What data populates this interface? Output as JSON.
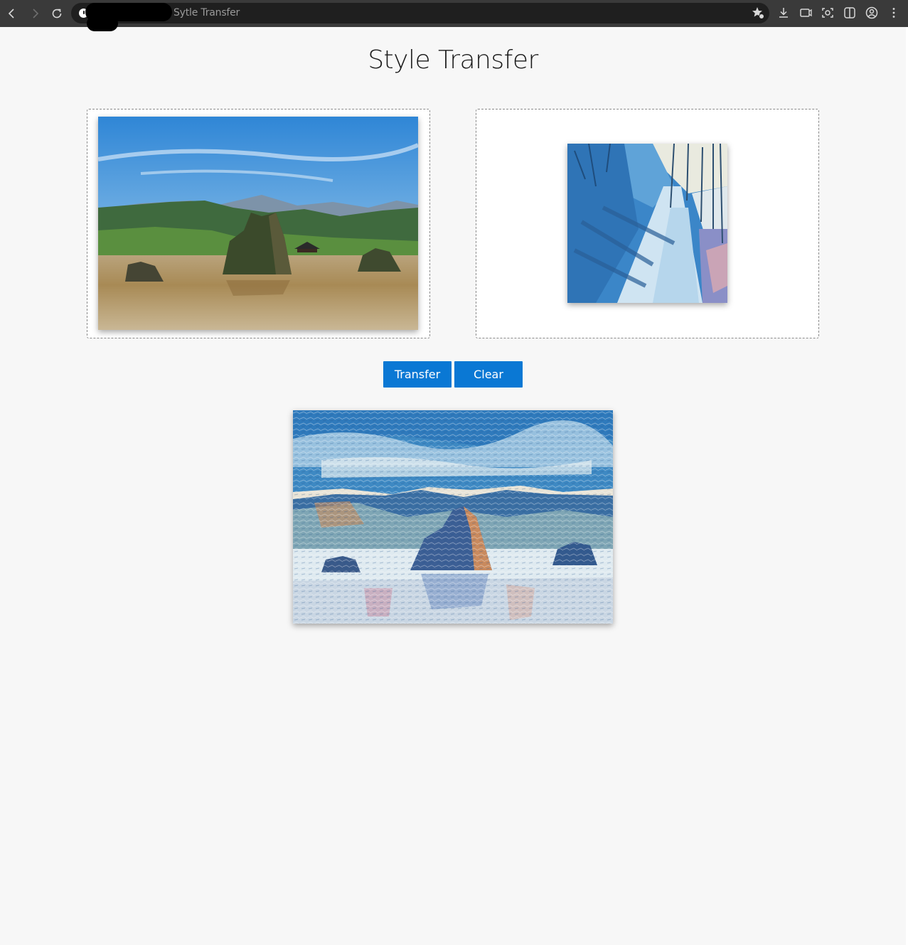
{
  "browser": {
    "tab_title": "Sytle Transfer",
    "icons": [
      "back-icon",
      "forward-icon",
      "reload-icon",
      "site-info-icon",
      "favorites-star-icon",
      "download-icon",
      "capture-icon",
      "screenshot-icon",
      "split-view-icon",
      "profile-icon",
      "menu-dots-icon"
    ]
  },
  "page": {
    "title": "Style Transfer"
  },
  "inputs": {
    "content_image": "content-landscape-river-rocks",
    "style_image": "style-painting-blue-path"
  },
  "buttons": {
    "transfer_label": "Transfer",
    "clear_label": "Clear"
  },
  "output": {
    "result_image": "stylized-result"
  },
  "colors": {
    "button_bg": "#0a78d4",
    "page_bg": "#f7f7f7",
    "chrome_bg": "#3a3a3a"
  }
}
